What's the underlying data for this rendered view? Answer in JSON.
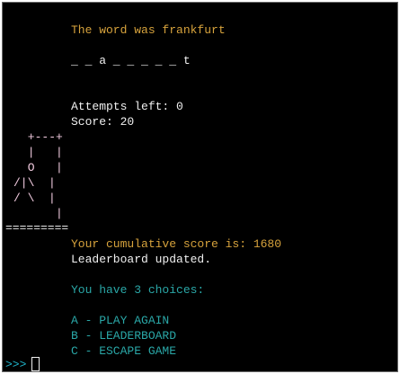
{
  "game": {
    "word_reveal": "The word was frankfurt",
    "masked_word": "_ _ a _ _ _ _ _ t",
    "attempts": "Attempts left: 0",
    "score": "Score: 20"
  },
  "hangman": {
    "line1": " +---+",
    "line2": " |   |",
    "line3": " O   |",
    "line4": "/|\\  |",
    "line5": "/ \\  |",
    "line6": "     |"
  },
  "separator": "=========",
  "results": {
    "cumulative": "Your cumulative score is: 1680",
    "leaderboard_status": "Leaderboard updated."
  },
  "menu": {
    "heading": "You have 3 choices:",
    "options": [
      "A - PLAY AGAIN",
      "B - LEADERBOARD",
      "C - ESCAPE GAME"
    ]
  },
  "prompt": ">>>",
  "colors": {
    "background": "#000000",
    "accent_orange": "#d6a23c",
    "menu_teal": "#2aa7a7",
    "prompt_cyan": "#1fb2c8",
    "hangman_pink": "#f2cbe0"
  }
}
